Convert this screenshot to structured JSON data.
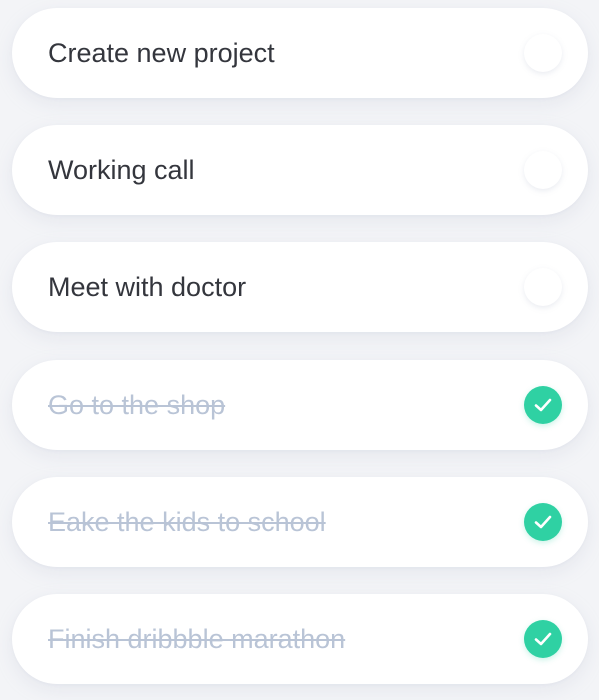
{
  "colors": {
    "background": "#f3f4f7",
    "card": "#ffffff",
    "text_pending": "#34363d",
    "text_done": "#b9c4d6",
    "check_done": "#2fd1a3"
  },
  "tasks": [
    {
      "label": "Create new project",
      "done": false,
      "icon": "empty-circle"
    },
    {
      "label": "Working call",
      "done": false,
      "icon": "empty-circle"
    },
    {
      "label": "Meet with doctor",
      "done": false,
      "icon": "empty-circle"
    },
    {
      "label": "Go to the shop",
      "done": true,
      "icon": "checkmark-icon"
    },
    {
      "label": "Eake the kids to school",
      "done": true,
      "icon": "checkmark-icon"
    },
    {
      "label": "Finish dribbble marathon",
      "done": true,
      "icon": "checkmark-icon"
    }
  ]
}
